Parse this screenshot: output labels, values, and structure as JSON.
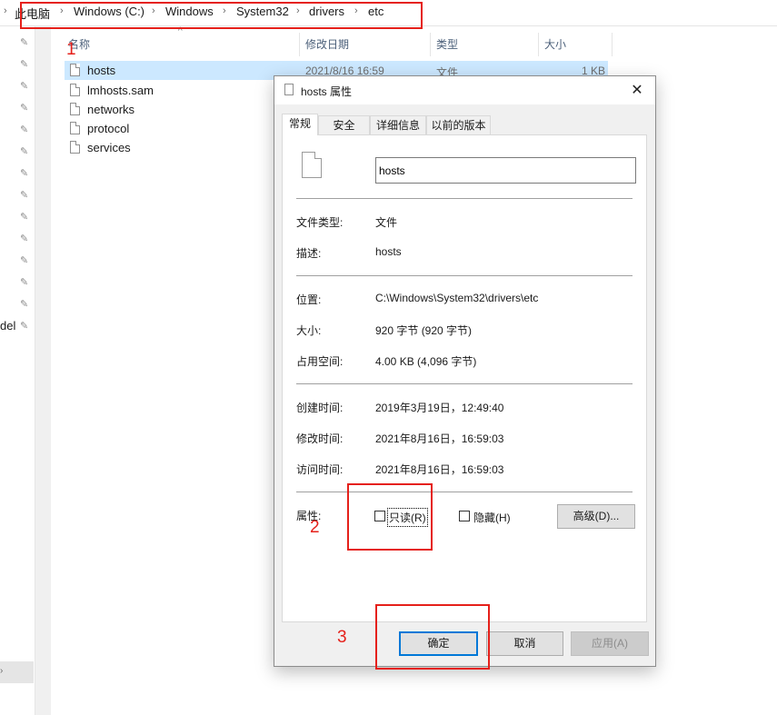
{
  "breadcrumb": {
    "segments": [
      "此电脑",
      "Windows (C:)",
      "Windows",
      "System32",
      "drivers",
      "etc"
    ],
    "separator": "›"
  },
  "nav": {
    "truncated_label": "del"
  },
  "columns": {
    "name": "名称",
    "date": "修改日期",
    "type": "类型",
    "size": "大小"
  },
  "files": [
    {
      "name": "hosts",
      "date": "2021/8/16 16:59",
      "type": "文件",
      "size": "1 KB"
    },
    {
      "name": "lmhosts.sam"
    },
    {
      "name": "networks"
    },
    {
      "name": "protocol"
    },
    {
      "name": "services"
    }
  ],
  "dialog": {
    "title": "hosts 属性",
    "close": "✕",
    "tabs": [
      "常规",
      "安全",
      "详细信息",
      "以前的版本"
    ],
    "filename": "hosts",
    "props": {
      "type_label": "文件类型:",
      "type_value": "文件",
      "desc_label": "描述:",
      "desc_value": "hosts",
      "location_label": "位置:",
      "location_value": "C:\\Windows\\System32\\drivers\\etc",
      "size_label": "大小:",
      "size_value": "920 字节 (920 字节)",
      "disk_label": "占用空间:",
      "disk_value": "4.00 KB (4,096 字节)",
      "created_label": "创建时间:",
      "created_value": "2019年3月19日，12:49:40",
      "modified_label": "修改时间:",
      "modified_value": "2021年8月16日，16:59:03",
      "accessed_label": "访问时间:",
      "accessed_value": "2021年8月16日，16:59:03",
      "attr_label": "属性:"
    },
    "readonly_label": "只读(R)",
    "readonly_checked": false,
    "hidden_label": "隐藏(H)",
    "hidden_checked": false,
    "advanced_label": "高级(D)...",
    "ok_label": "确定",
    "cancel_label": "取消",
    "apply_label": "应用(A)"
  },
  "annotations": {
    "color": "#e5201a",
    "labels": [
      "1",
      "2",
      "3"
    ]
  }
}
